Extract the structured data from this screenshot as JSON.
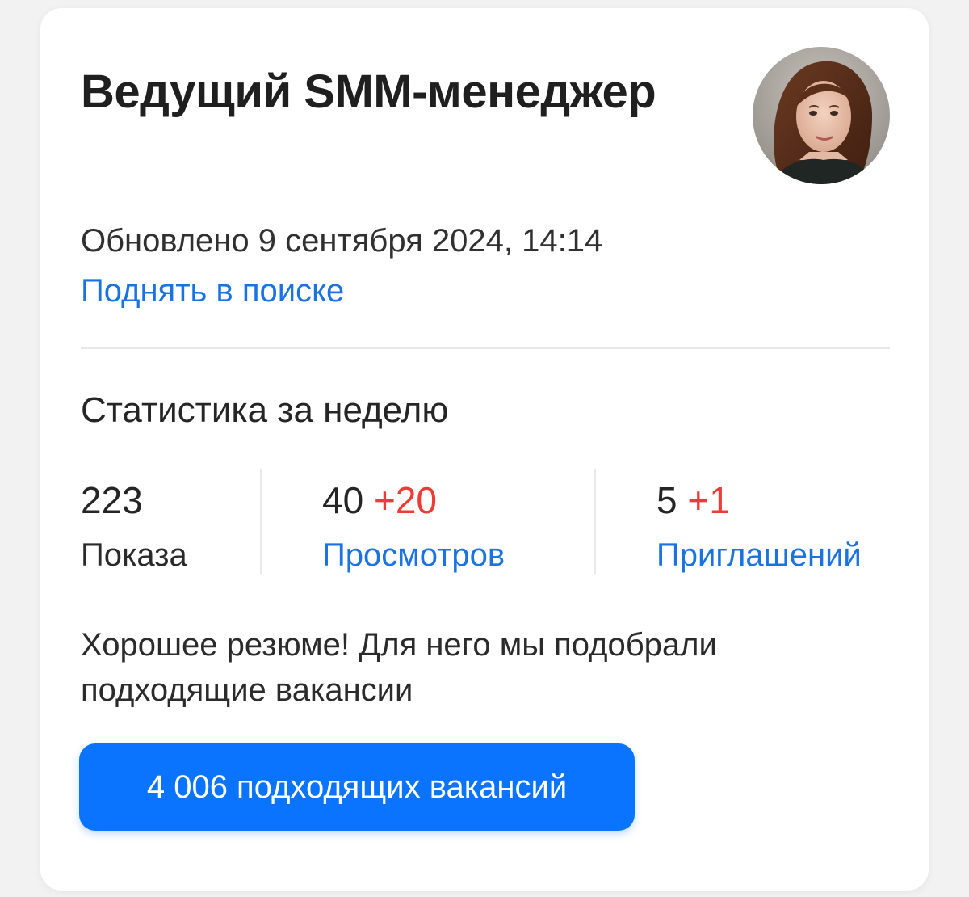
{
  "resume": {
    "title": "Ведущий SMM-менеджер",
    "updated_text": "Обновлено 9 сентября 2024, 14:14",
    "raise_link": "Поднять в поиске"
  },
  "stats": {
    "heading": "Статистика за неделю",
    "impressions": {
      "value": "223",
      "label": "Показа"
    },
    "views": {
      "value": "40",
      "delta": "+20",
      "label": "Просмотров"
    },
    "invitations": {
      "value": "5",
      "delta": "+1",
      "label": "Приглашений"
    }
  },
  "recommendation": {
    "message": "Хорошее резюме! Для него мы подобрали подходящие вакансии",
    "button_label": "4 006 подходящих вакансий"
  },
  "colors": {
    "link": "#1a73e0",
    "delta": "#ef3b35",
    "button": "#0a74ff"
  },
  "avatar_icon": "user-photo"
}
